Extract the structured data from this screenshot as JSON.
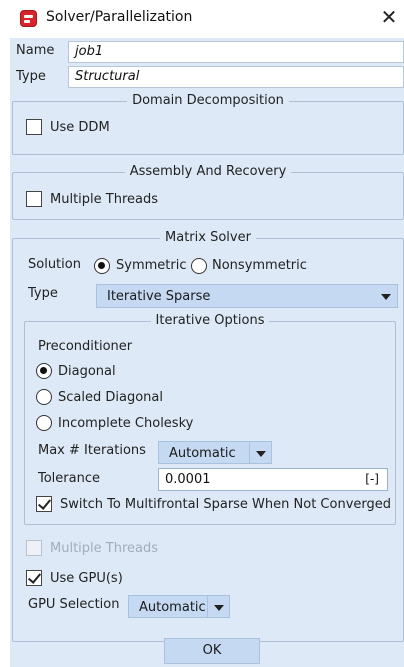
{
  "window": {
    "title": "Solver/Parallelization",
    "close_symbol": "✕"
  },
  "job": {
    "name_label": "Name",
    "name_value": "job1",
    "type_label": "Type",
    "type_value": "Structural"
  },
  "domain_decomposition": {
    "title": "Domain Decomposition",
    "use_ddm_label": "Use DDM",
    "use_ddm_checked": false
  },
  "assembly_recovery": {
    "title": "Assembly And Recovery",
    "multiple_threads_label": "Multiple Threads",
    "multiple_threads_checked": false
  },
  "matrix_solver": {
    "title": "Matrix Solver",
    "solution_label": "Solution",
    "symmetric_label": "Symmetric",
    "nonsymmetric_label": "Nonsymmetric",
    "solution_selected": "Symmetric",
    "type_label": "Type",
    "type_value": "Iterative Sparse"
  },
  "iterative_options": {
    "title": "Iterative Options",
    "preconditioner_label": "Preconditioner",
    "preconditioners": [
      "Diagonal",
      "Scaled Diagonal",
      "Incomplete Cholesky"
    ],
    "preconditioner_selected": "Diagonal",
    "max_iterations_label": "Max # Iterations",
    "max_iterations_value": "Automatic",
    "tolerance_label": "Tolerance",
    "tolerance_value": "0.0001",
    "tolerance_unit": "[-]",
    "switch_label": "Switch To Multifrontal Sparse When Not Converged",
    "switch_checked": true
  },
  "gpu": {
    "multiple_threads_label": "Multiple Threads",
    "multiple_threads_checked": false,
    "multiple_threads_enabled": false,
    "use_gpu_label": "Use GPU(s)",
    "use_gpu_checked": true,
    "gpu_selection_label": "GPU Selection",
    "gpu_selection_value": "Automatic"
  },
  "footer": {
    "ok_label": "OK"
  },
  "colors": {
    "panel_background": "#dde9f7",
    "combo_background": "#c5daf2",
    "app_icon": "#d8242b"
  }
}
